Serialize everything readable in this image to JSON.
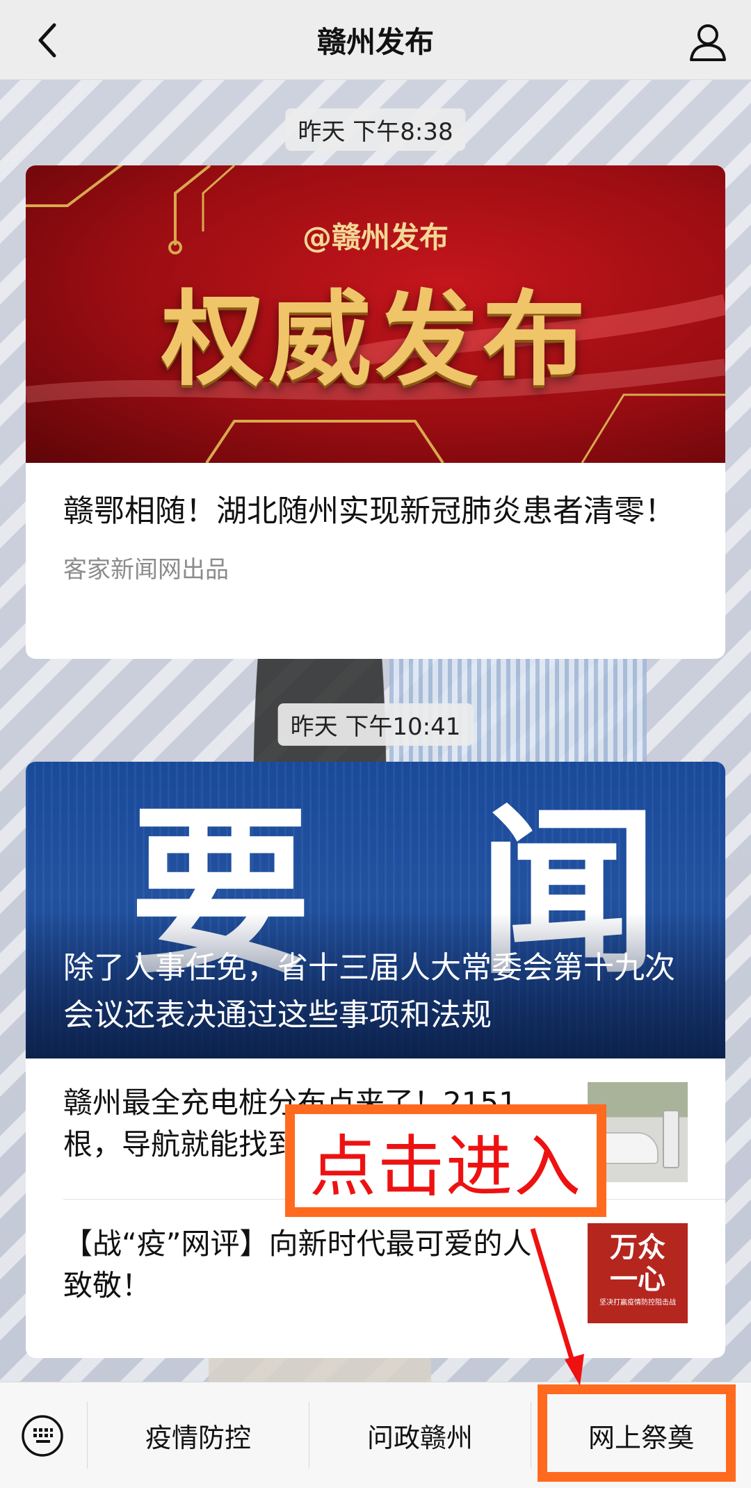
{
  "header": {
    "title": "赣州发布"
  },
  "messages": [
    {
      "time": "昨天 下午8:38",
      "cover_handle": "@赣州发布",
      "cover_title": "权威发布",
      "headline": "赣鄂相随！湖北随州实现新冠肺炎患者清零！",
      "source": "客家新闻网出品"
    },
    {
      "time": "昨天 下午10:41",
      "cover_chars": [
        "要",
        "闻"
      ],
      "cover_title": "除了人事任免，省十三届人大常委会第十九次会议还表决通过这些事项和法规",
      "items": [
        {
          "text": "赣州最全充电桩分布点来了！2151根，导航就能找到"
        },
        {
          "text": "【战“疫”网评】向新时代最可爱的人致敬！",
          "thumb_line1": "万众",
          "thumb_line2": "一心",
          "thumb_caption": "坚决打赢疫情防控阻击战"
        }
      ]
    }
  ],
  "menu": {
    "items": [
      "疫情防控",
      "问政赣州",
      "网上祭奠"
    ]
  },
  "annotation": {
    "label": "点击进入",
    "color": "#ff6a1f",
    "text_color": "#ee1111"
  }
}
